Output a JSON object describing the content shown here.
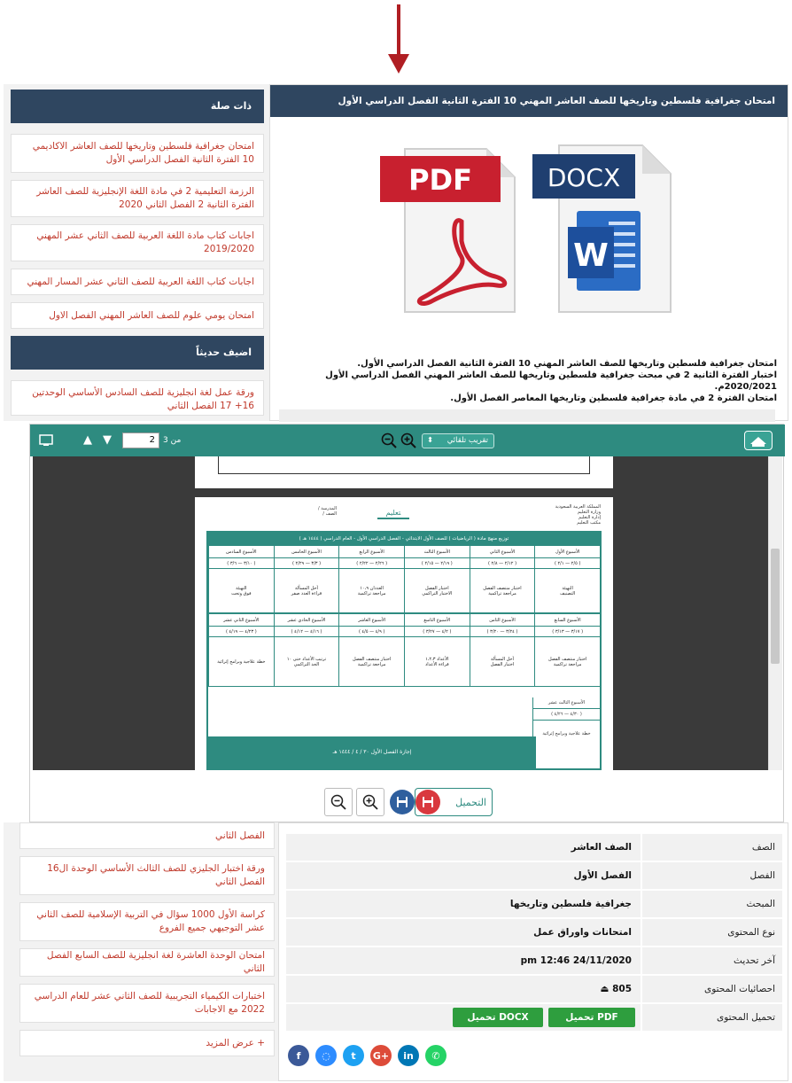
{
  "colors": {
    "navy": "#2f4660",
    "teal": "#2e8b80",
    "link_red": "#c0392b",
    "green": "#2e9e3e",
    "arrow_red": "#b01e23"
  },
  "sidebar_top": {
    "heading_related": "ذات صلة",
    "related_links": [
      "امتحان جغرافية فلسطين وتاريخها للصف العاشر الاكاديمي 10 الفترة الثانية الفصل الدراسي الأول",
      "الرزمة التعليمية 2 في مادة اللغة الإنجليزية للصف العاشر الفترة الثانية 2 الفصل الثاني 2020",
      "اجابات كتاب مادة اللغة العربية للصف الثاني عشر المهني 2019/2020",
      "اجابات كتاب اللغة العربية للصف الثاني عشر المسار المهني",
      "امتحان يومي علوم للصف العاشر المهني الفصل الاول"
    ],
    "heading_recent": "اضيف حديثاً",
    "recent_first": "ورقة عمل لغة انجليزية للصف السادس الأساسي الوحدتين 16+ 17 الفصل الثاني"
  },
  "main": {
    "title": "امتحان جغرافية فلسطين وتاريخها للصف العاشر المهني 10 الفترة الثانية الفصل الدراسي الأول",
    "pdf_label": "PDF",
    "docx_label": "DOCX",
    "description": [
      "امتحان جغرافية فلسطين وتاريخها للصف العاشر المهني 10 الفترة الثانية الفصل الدراسي الأول.",
      "اختبار الفترة الثانية 2 في مبحث جغرافية فلسطين وتاريخها للصف العاشر المهني الفصل الدراسي الأول 2020/2021م.",
      "امتحان الفترة 2 في مادة جغرافية فلسطين وتاريخها المعاصر الفصل الأول."
    ]
  },
  "viewer": {
    "page_current": "2",
    "page_total_label": "من 3",
    "zoom_option": "تقريب تلقائي",
    "download_label": "التحميل",
    "doc": {
      "header_right": [
        "المملكة العربية السعودية",
        "وزارة التعليم",
        "إدارة التعليم",
        "مكتب التعليم"
      ],
      "header_left": [
        "المدرسة /",
        "الصف /"
      ],
      "schedule_title": "توزيع منهج مادة ( الرياضيات ) للصف الأول الابتدائي - الفصل الدراسي الأول - العام الدراسي ( ١٤٤٤ هـ )",
      "weeks_row1": [
        "الأسبوع الأول",
        "الأسبوع الثاني",
        "الأسبوع الثالث",
        "الأسبوع الرابع",
        "الأسبوع الخامس",
        "الأسبوع السادس"
      ],
      "weeks_row2": [
        "الأسبوع السابع",
        "الأسبوع الثامن",
        "الأسبوع التاسع",
        "الأسبوع العاشر",
        "الأسبوع الحادي عشر",
        "الأسبوع الثاني عشر"
      ],
      "week_13": "الأسبوع الثالث عشر",
      "plan_text": "خطة علاجية وبرامج إثرائية",
      "footer_band": "إجازة الفصل الأول ٣٠ / ٤ / ١٤٤٤ هـ"
    }
  },
  "info": {
    "rows": [
      {
        "key": "الصف",
        "value": "الصف العاشر"
      },
      {
        "key": "الفصل",
        "value": "الفصل الأول"
      },
      {
        "key": "المبحث",
        "value": "جغرافية فلسطين وتاريخها"
      },
      {
        "key": "نوع المحتوى",
        "value": "امتحانات واوراق عمل"
      },
      {
        "key": "آخر تحديث",
        "value": "24/11/2020 12:46 pm"
      },
      {
        "key": "احصائيات المحتوى",
        "value": "805"
      },
      {
        "key": "تحميل المحتوى",
        "value": ""
      }
    ],
    "btn_pdf": "تحميل PDF",
    "btn_docx": "تحميل DOCX"
  },
  "sidebar_bottom": {
    "partial_top": "الفصل الثاني",
    "links": [
      "ورقة اختبار الجليزي للصف الثالث الأساسي الوحدة ال16 الفصل الثاني",
      "كراسة الأول 1000 سؤال في التربية الإسلامية للصف الثاني عشر التوجيهي جميع الفروع",
      "امتحان الوحدة العاشرة لغة انجليزية للصف السابع الفصل الثاني",
      "اختبارات الكيمياء التجريبية للصف الثاني عشر للعام الدراسي 2022 مع الاجابات"
    ],
    "more": "+ عرض المزيد"
  },
  "social": [
    "facebook",
    "messenger",
    "twitter",
    "google-plus",
    "linkedin",
    "whatsapp"
  ]
}
